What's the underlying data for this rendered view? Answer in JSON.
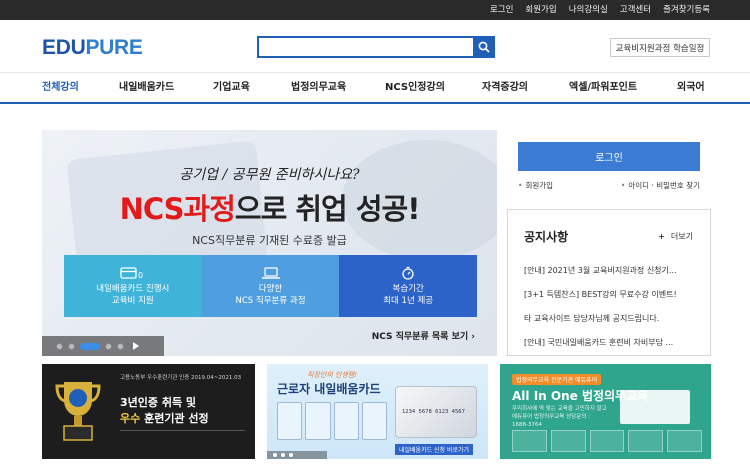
{
  "topbar": {
    "links": [
      "로그인",
      "회원가입",
      "나의강의실",
      "고객센터",
      "즐겨찾기등록"
    ]
  },
  "header": {
    "logo_part1": "EDU",
    "logo_part2": "PURE",
    "search_placeholder": "",
    "schedule_button": "교육비지원과정 학습일정"
  },
  "nav": {
    "items": [
      "전체강의",
      "내일배움카드",
      "기업교육",
      "법정의무교육",
      "NCS인정강의",
      "자격증강의",
      "엑셀/파워포인트",
      "외국어"
    ],
    "active_index": 0
  },
  "hero": {
    "handwritten": "공기업 / 공무원 준비하시나요?",
    "headline_red": "NCS과정",
    "headline_rest": "으로 취업 성공!",
    "subline": "NCS직무분류 기재된 수료증 발급",
    "features": [
      {
        "icon": "card-icon",
        "line1": "내일배움카드 진행시",
        "line2": "교육비 지원"
      },
      {
        "icon": "laptop-icon",
        "line1": "다양한",
        "line2": "NCS 직무분류 과정"
      },
      {
        "icon": "stopwatch-icon",
        "line1": "복습기간",
        "line2": "최대 1년 제공"
      }
    ],
    "list_link": "NCS 직무분류 목록 보기",
    "slide_count": 5,
    "active_slide": 3
  },
  "login": {
    "button": "로그인",
    "join": "회원가입",
    "find": "아이디 · 비밀번호 찾기"
  },
  "notice": {
    "title": "공지사항",
    "more": "더보기",
    "items": [
      "[안내] 2021년 3월 교육비지원과정 신청기...",
      "[3+1 득템찬스] BEST강의 무료수강 이벤트!",
      "타 교육사이트 담당자님께 공지드립니다.",
      "[안내] 국민내일배움카드 훈련비 자비부담 ..."
    ]
  },
  "banners": {
    "b1": {
      "tag": "고용노동부 우수훈련기관 인증 2019.04~2021.03",
      "line1": "3년인증 취득 및",
      "line2_highlight": "우수",
      "line2_rest": " 훈련기관 선정"
    },
    "b2": {
      "kicker": "직장인의 인생템!",
      "big": "근로자 내일배움카드",
      "card_number": "1234 5678 6123 4567",
      "cta": "내일배움카드 신청 바로가기"
    },
    "b3": {
      "badge": "법정의무교육 전문기관 에듀퓨어",
      "big": "All In One 법정의무교육",
      "small": "우리회사에 딱 맞는 교육을 고민하지 말고 에듀퓨어 법정의무교육 상담문의 : 1688-3764"
    }
  },
  "colors": {
    "brand_blue": "#1f5fb8",
    "logo_light": "#2f7fd0",
    "headline_red": "#e11a1a",
    "login_blue": "#3b7bd4",
    "banner_green": "#2ea58c"
  }
}
